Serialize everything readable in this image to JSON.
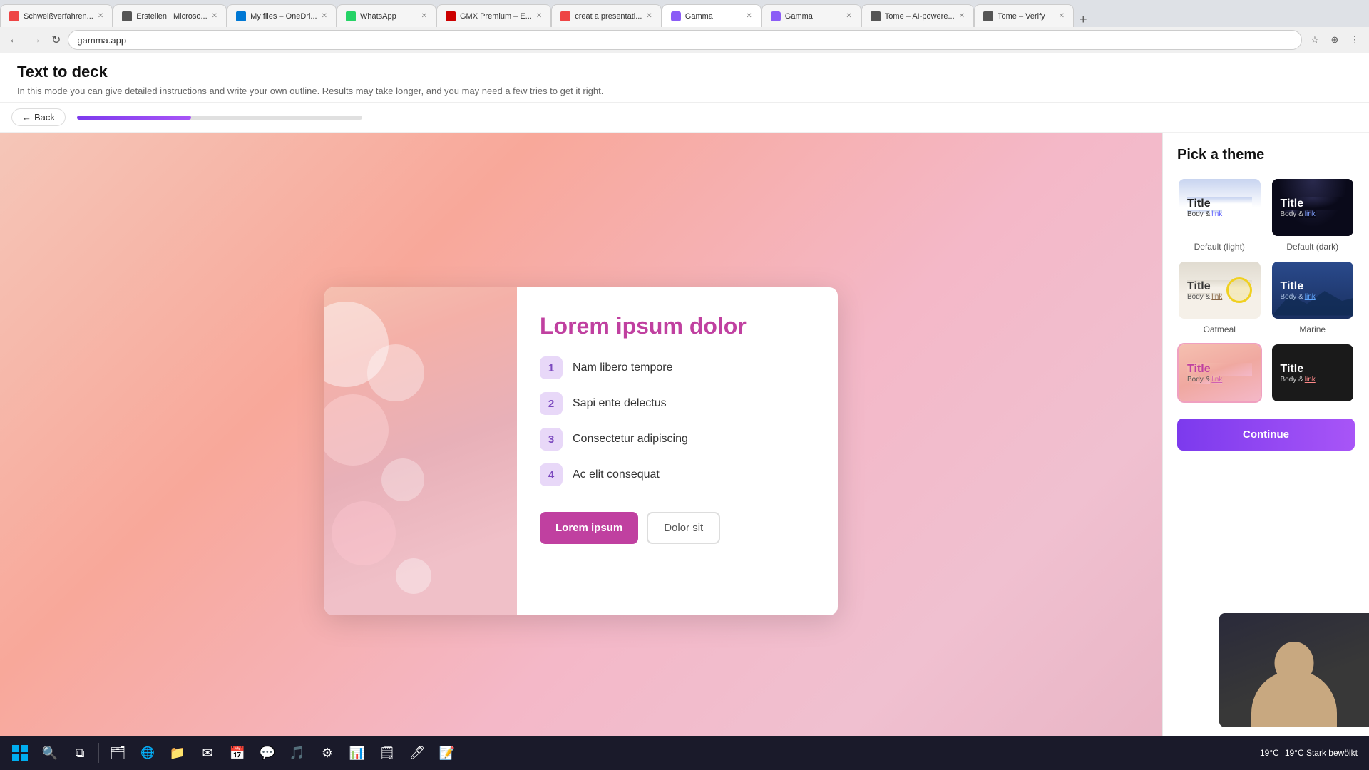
{
  "browser": {
    "tabs": [
      {
        "label": "Schweißverfahren...",
        "active": false,
        "color": "#e44"
      },
      {
        "label": "Erstellen | Microsо...",
        "active": false,
        "color": "#555"
      },
      {
        "label": "My files – OneDri...",
        "active": false,
        "color": "#0078d4"
      },
      {
        "label": "WhatsApp",
        "active": false,
        "color": "#25d366"
      },
      {
        "label": "GMX Premium – E...",
        "active": false,
        "color": "#c00"
      },
      {
        "label": "creat a presentati...",
        "active": false,
        "color": "#e44"
      },
      {
        "label": "Gamma",
        "active": true,
        "color": "#8b5cf6"
      },
      {
        "label": "Gamma",
        "active": false,
        "color": "#8b5cf6"
      },
      {
        "label": "Tome – AI-powere...",
        "active": false,
        "color": "#555"
      },
      {
        "label": "Tome – Verify",
        "active": false,
        "color": "#555"
      }
    ],
    "address": "gamma.app"
  },
  "header": {
    "title": "Text to deck",
    "subtitle": "In this mode you can give detailed instructions and write your own outline. Results may take longer, and you may need a few tries to get it right."
  },
  "toolbar": {
    "back_label": "Back",
    "progress_percent": 40
  },
  "slide": {
    "heading": "Lorem ipsum dolor",
    "list_items": [
      {
        "number": "1",
        "text": "Nam libero tempore"
      },
      {
        "number": "2",
        "text": "Sapi ente delectus"
      },
      {
        "number": "3",
        "text": "Consectetur adipiscing"
      },
      {
        "number": "4",
        "text": "Ac elit consequat"
      }
    ],
    "button_primary": "Lorem ipsum",
    "button_secondary": "Dolor sit"
  },
  "theme_panel": {
    "title": "Pick a theme",
    "themes": [
      {
        "id": "default-light",
        "name": "Default (light)",
        "style": "light",
        "title": "Title",
        "body": "Body & ",
        "link": "link"
      },
      {
        "id": "default-dark",
        "name": "Default (dark)",
        "style": "dark",
        "title": "Title",
        "body": "Body & ",
        "link": "link"
      },
      {
        "id": "oatmeal",
        "name": "Oatmeal",
        "style": "oatmeal",
        "title": "Title",
        "body": "Body & ",
        "link": "link"
      },
      {
        "id": "marine",
        "name": "Marine",
        "style": "marine",
        "title": "Title",
        "body": "Body & ",
        "link": "link"
      },
      {
        "id": "peach",
        "name": "",
        "style": "peach",
        "title": "Title",
        "body": "Body & ",
        "link": "link"
      },
      {
        "id": "darkalt",
        "name": "",
        "style": "darkalt",
        "title": "Title",
        "body": "Body & ",
        "link": "link"
      }
    ],
    "cta_label": "Continue"
  },
  "taskbar": {
    "weather": "19°C  Stark bewölkt",
    "items": [
      "⊞",
      "🗂",
      "🌐",
      "📁",
      "✉",
      "📅",
      "💬",
      "🎵",
      "🔧",
      "📊",
      "🗒",
      "🖊",
      "⚙"
    ]
  }
}
